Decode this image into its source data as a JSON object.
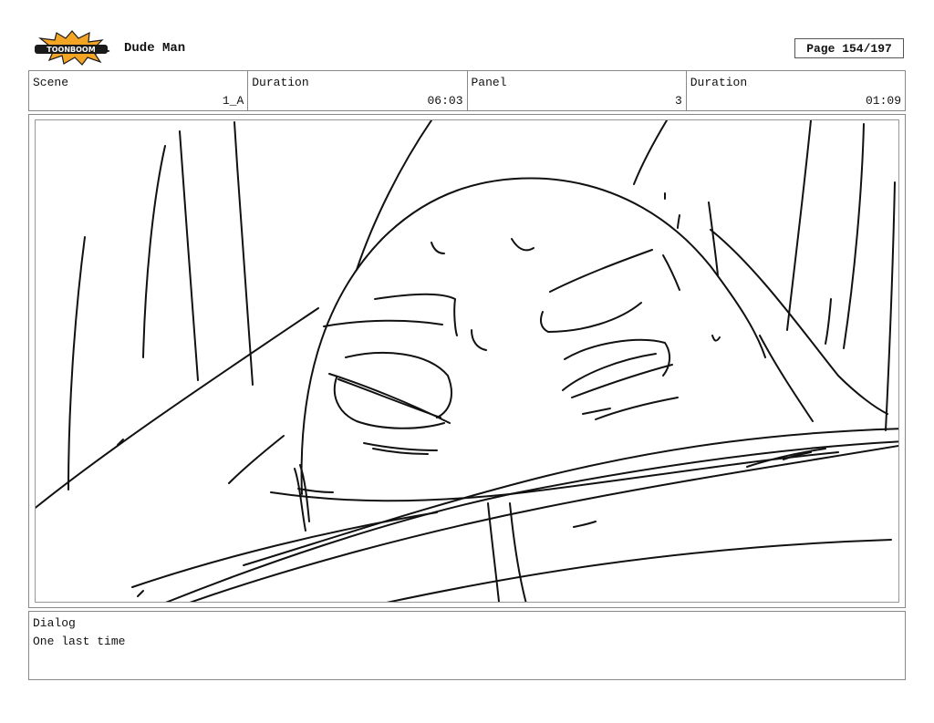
{
  "header": {
    "logo_text": "TOONBOOM",
    "project_title": "Dude Man",
    "page_label": "Page 154/197"
  },
  "info": {
    "scene_label": "Scene",
    "scene_value": "1_A",
    "duration_label": "Duration",
    "duration_value": "06:03",
    "panel_label": "Panel",
    "panel_value": "3",
    "panel_duration_label": "Duration",
    "panel_duration_value": "01:09"
  },
  "dialog": {
    "label": "Dialog",
    "text": "One last time"
  },
  "colors": {
    "logo_orange": "#f5a524",
    "logo_dark": "#1a1a1a",
    "border": "#888888"
  }
}
